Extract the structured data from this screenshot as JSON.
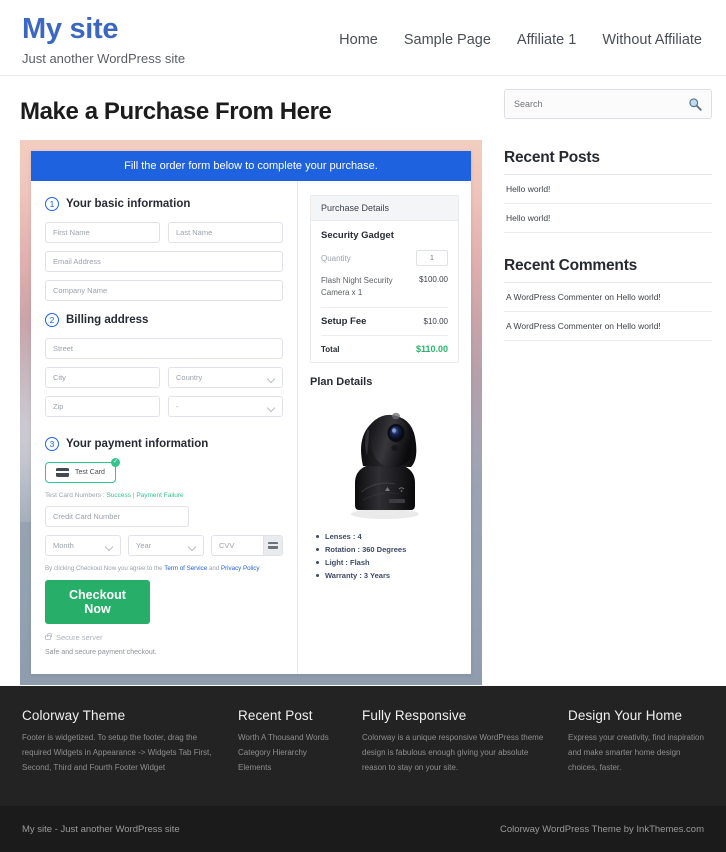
{
  "header": {
    "site_title": "My site",
    "tagline": "Just another WordPress site",
    "nav": [
      {
        "label": "Home"
      },
      {
        "label": "Sample Page"
      },
      {
        "label": "Affiliate 1"
      },
      {
        "label": "Without Affiliate"
      }
    ]
  },
  "main": {
    "page_title": "Make a Purchase From Here",
    "order_banner": "Fill the order form below to complete your purchase.",
    "steps": {
      "step1_num": "1",
      "step1_title": "Your basic information",
      "step2_num": "2",
      "step2_title": "Billing address",
      "step3_num": "3",
      "step3_title": "Your payment information"
    },
    "fields": {
      "first_name": "First Name",
      "last_name": "Last Name",
      "email": "Email Address",
      "company": "Company Name",
      "street": "Street",
      "city": "City",
      "country": "Country",
      "zip": "Zip",
      "state": "-",
      "credit_card": "Credit Card Number",
      "month": "Month",
      "year": "Year",
      "cvv": "CVV"
    },
    "payment": {
      "method_label": "Test Card",
      "method_check": "✓",
      "test_card_prefix": "Test Card Numbers : ",
      "test_card_success": "Success",
      "test_card_sep": " | ",
      "test_card_failure": "Payment Failure",
      "terms_prefix": "By clicking Checkout Now you agree to the ",
      "terms_tos": "Term of Service",
      "terms_and": " and ",
      "terms_privacy": "Privacy Policy",
      "checkout_button": "Checkout Now",
      "secure_server": "Secure server",
      "safe_note": "Safe and secure payment checkout."
    },
    "purchase_details": {
      "heading": "Purchase Details",
      "product": "Security Gadget",
      "quantity_label": "Quantity",
      "quantity_value": "1",
      "item_name": "Flash Night Security Camera x 1",
      "item_price": "$100.00",
      "setup_fee_label": "Setup Fee",
      "setup_fee_price": "$10.00",
      "total_label": "Total",
      "total_price": "$110.00"
    },
    "plan_details": {
      "heading": "Plan Details",
      "specs": [
        "Lenses : 4",
        "Rotation : 360 Degrees",
        "Light : Flash",
        "Warranty : 3 Years"
      ]
    }
  },
  "sidebar": {
    "search_placeholder": "Search",
    "recent_posts_title": "Recent Posts",
    "recent_posts": [
      {
        "label": "Hello world!"
      },
      {
        "label": "Hello world!"
      }
    ],
    "recent_comments_title": "Recent Comments",
    "recent_comments": [
      {
        "label": "A WordPress Commenter on Hello world!"
      },
      {
        "label": "A WordPress Commenter on Hello world!"
      }
    ]
  },
  "footer": {
    "columns": [
      {
        "title": "Colorway Theme",
        "text": "Footer is widgetized. To setup the footer, drag the required Widgets in Appearance -> Widgets Tab First, Second, Third and Fourth Footer Widget"
      },
      {
        "title": "Recent Post",
        "items": [
          {
            "label": "Worth A Thousand Words"
          },
          {
            "label": "Category Hierarchy"
          },
          {
            "label": "Elements"
          }
        ]
      },
      {
        "title": "Fully Responsive",
        "text": "Colorway is a unique responsive WordPress theme design is fabulous enough giving your absolute reason to stay on your site."
      },
      {
        "title": "Design Your Home",
        "text": "Express your creativity, find inspiration and make smarter home design choices, faster."
      }
    ],
    "bottom_left": "My site - Just another WordPress site",
    "bottom_right": "Colorway WordPress Theme by InkThemes.com"
  },
  "colors": {
    "brand_blue": "#3b66c4",
    "banner_blue": "#1f62e0",
    "accent_green": "#27ae69",
    "total_green": "#2ab36a",
    "footer_dark": "#232323"
  }
}
